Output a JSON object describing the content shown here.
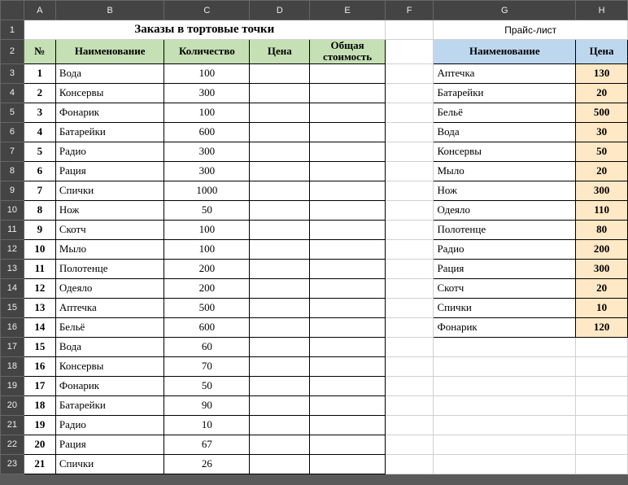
{
  "columns": [
    "A",
    "B",
    "C",
    "D",
    "E",
    "F",
    "G",
    "H"
  ],
  "titles": {
    "orders": "Заказы в тортовые точки",
    "pricelist": "Прайс-лист"
  },
  "orders_header": {
    "num": "№",
    "name": "Наименование",
    "qty": "Количество",
    "price": "Цена",
    "total": "Общая стоимость"
  },
  "price_header": {
    "name": "Наименование",
    "price": "Цена"
  },
  "orders": [
    {
      "n": "1",
      "name": "Вода",
      "qty": "100"
    },
    {
      "n": "2",
      "name": "Консервы",
      "qty": "300"
    },
    {
      "n": "3",
      "name": "Фонарик",
      "qty": "100"
    },
    {
      "n": "4",
      "name": "Батарейки",
      "qty": "600"
    },
    {
      "n": "5",
      "name": "Радио",
      "qty": "300"
    },
    {
      "n": "6",
      "name": "Рация",
      "qty": "300"
    },
    {
      "n": "7",
      "name": "Спички",
      "qty": "1000"
    },
    {
      "n": "8",
      "name": "Нож",
      "qty": "50"
    },
    {
      "n": "9",
      "name": "Скотч",
      "qty": "100"
    },
    {
      "n": "10",
      "name": "Мыло",
      "qty": "100"
    },
    {
      "n": "11",
      "name": "Полотенце",
      "qty": "200"
    },
    {
      "n": "12",
      "name": "Одеяло",
      "qty": "200"
    },
    {
      "n": "13",
      "name": "Аптечка",
      "qty": "500"
    },
    {
      "n": "14",
      "name": "Бельё",
      "qty": "600"
    },
    {
      "n": "15",
      "name": "Вода",
      "qty": "60"
    },
    {
      "n": "16",
      "name": "Консервы",
      "qty": "70"
    },
    {
      "n": "17",
      "name": "Фонарик",
      "qty": "50"
    },
    {
      "n": "18",
      "name": "Батарейки",
      "qty": "90"
    },
    {
      "n": "19",
      "name": "Радио",
      "qty": "10"
    },
    {
      "n": "20",
      "name": "Рация",
      "qty": "67"
    },
    {
      "n": "21",
      "name": "Спички",
      "qty": "26"
    }
  ],
  "pricelist": [
    {
      "name": "Аптечка",
      "price": "130"
    },
    {
      "name": "Батарейки",
      "price": "20"
    },
    {
      "name": "Бельё",
      "price": "500"
    },
    {
      "name": "Вода",
      "price": "30"
    },
    {
      "name": "Консервы",
      "price": "50"
    },
    {
      "name": "Мыло",
      "price": "20"
    },
    {
      "name": "Нож",
      "price": "300"
    },
    {
      "name": "Одеяло",
      "price": "110"
    },
    {
      "name": "Полотенце",
      "price": "80"
    },
    {
      "name": "Радио",
      "price": "200"
    },
    {
      "name": "Рация",
      "price": "300"
    },
    {
      "name": "Скотч",
      "price": "20"
    },
    {
      "name": "Спички",
      "price": "10"
    },
    {
      "name": "Фонарик",
      "price": "120"
    }
  ]
}
